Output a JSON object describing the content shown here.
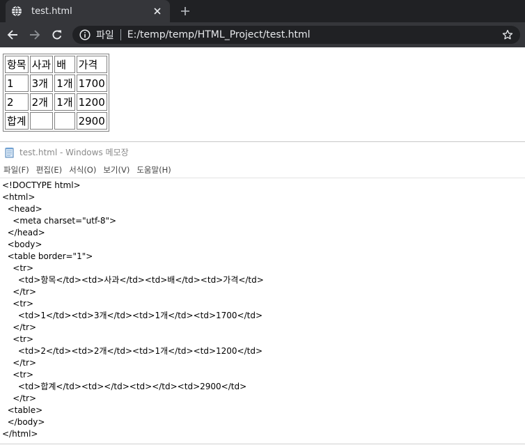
{
  "browser": {
    "tab": {
      "title": "test.html"
    },
    "omnibox": {
      "scheme": "파일",
      "url": "E:/temp/temp/HTML_Project/test.html"
    },
    "icons": [
      "globe-icon",
      "close-icon",
      "plus-icon",
      "back-arrow-icon",
      "forward-arrow-icon",
      "reload-icon",
      "info-icon",
      "star-icon"
    ],
    "table": {
      "rows": [
        [
          "항목",
          "사과",
          "배",
          "가격"
        ],
        [
          "1",
          "3개",
          "1개",
          "1700"
        ],
        [
          "2",
          "2개",
          "1개",
          "1200"
        ],
        [
          "합계",
          "",
          "",
          "2900"
        ]
      ]
    },
    "colors": {
      "tabstrip": "#202124",
      "toolbar": "#35363a",
      "omnibox": "#202124",
      "text": "#e8eaed"
    }
  },
  "notepad": {
    "title": "test.html - Windows 메모장",
    "menu": [
      "파일(F)",
      "편집(E)",
      "서식(O)",
      "보기(V)",
      "도움말(H)"
    ],
    "lines": [
      "<!DOCTYPE html>",
      "<html>",
      "  <head>",
      "    <meta charset=\"utf-8\">",
      "  </head>",
      "  <body>",
      "  <table border=\"1\">",
      "    <tr>",
      "      <td>항목</td><td>사과</td><td>배</td><td>가격</td>",
      "    </tr>",
      "    <tr>",
      "      <td>1</td><td>3개</td><td>1개</td><td>1700</td>",
      "    </tr>",
      "    <tr>",
      "      <td>2</td><td>2개</td><td>1개</td><td>1200</td>",
      "    </tr>",
      "    <tr>",
      "      <td>합계</td><td></td><td></td><td>2900</td>",
      "    </tr>",
      "  <table>",
      "  </body>",
      "</html>"
    ]
  }
}
